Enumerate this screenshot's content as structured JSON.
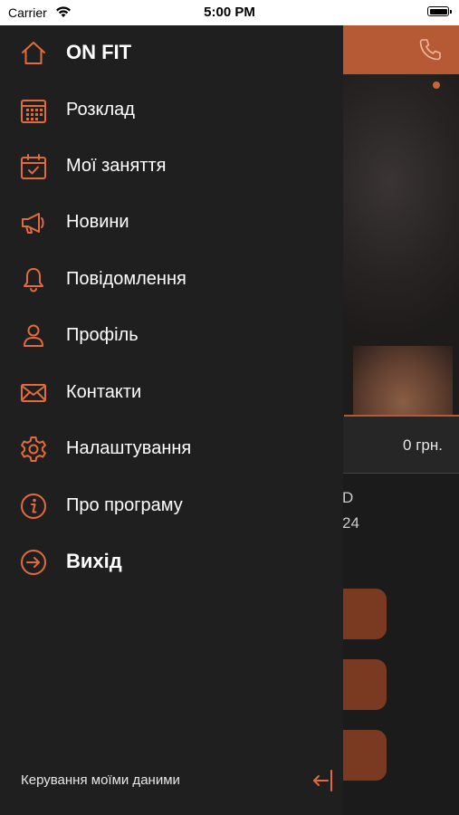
{
  "status_bar": {
    "carrier": "Carrier",
    "time": "5:00 PM"
  },
  "menu": {
    "items": [
      {
        "label": "ON FIT",
        "icon": "home-icon"
      },
      {
        "label": "Розклад",
        "icon": "calendar-grid-icon"
      },
      {
        "label": "Мої заняття",
        "icon": "calendar-check-icon"
      },
      {
        "label": "Новини",
        "icon": "megaphone-icon"
      },
      {
        "label": "Повідомлення",
        "icon": "bell-icon"
      },
      {
        "label": "Профіль",
        "icon": "user-icon"
      },
      {
        "label": "Контакти",
        "icon": "envelope-icon"
      },
      {
        "label": "Налаштування",
        "icon": "gear-icon"
      },
      {
        "label": "Про програму",
        "icon": "info-icon"
      },
      {
        "label": "Вихід",
        "icon": "logout-arrow-icon"
      }
    ]
  },
  "footer": {
    "manage_data": "Керування моїми даними"
  },
  "background": {
    "price": "0 грн.",
    "text1": "D",
    "text2": "24"
  },
  "colors": {
    "accent": "#e26b3d",
    "drawer_bg": "#1f1f1f",
    "header_bg": "#b65a35"
  }
}
